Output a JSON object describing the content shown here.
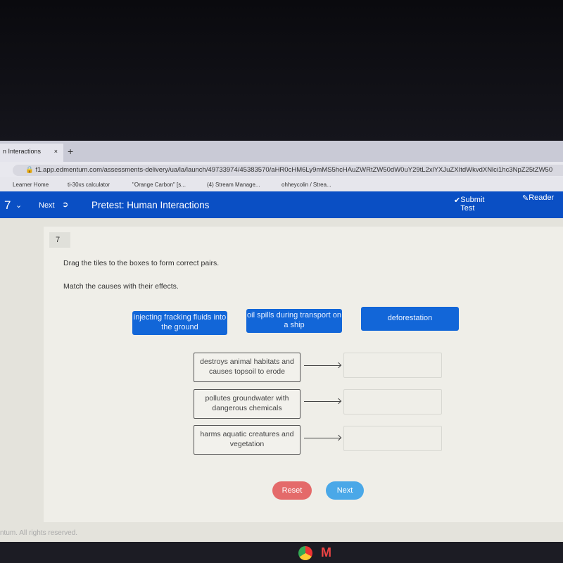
{
  "browser": {
    "tab_title": "n Interactions",
    "tab_close": "×",
    "new_tab": "+",
    "url": "f1.app.edmentum.com/assessments-delivery/ua/la/launch/49733974/45383570/aHR0cHM6Ly9mMS5hcHAuZWRtZW50dW0uY29tL2xlYXJuZXItdWkvdXNlci1hc3NpZ25tZW50",
    "bookmarks": [
      "Learner Home",
      "ti-30xs calculator",
      "\"Orange Carbon\" [s...",
      "(4) Stream Manage...",
      "ohheycolin / Strea..."
    ]
  },
  "nav": {
    "question_selector": "7",
    "next_label": "Next",
    "title": "Pretest: Human Interactions",
    "submit_label": "Submit Test",
    "reader_label": "Reader"
  },
  "question": {
    "number": "7",
    "instruction": "Drag the tiles to the boxes to form correct pairs.",
    "prompt": "Match the causes with their effects.",
    "tiles": [
      "injecting fracking fluids into the ground",
      "oil spills during transport on a ship",
      "deforestation"
    ],
    "effects": [
      "destroys animal habitats and causes topsoil to erode",
      "pollutes groundwater with dangerous chemicals",
      "harms aquatic creatures and vegetation"
    ]
  },
  "buttons": {
    "reset": "Reset",
    "next": "Next"
  },
  "footer": "ntum. All rights reserved.",
  "colors": {
    "nav": "#0a4fc4",
    "tile": "#1266d8",
    "reset": "#e46a6a",
    "next": "#4aa8e8"
  }
}
